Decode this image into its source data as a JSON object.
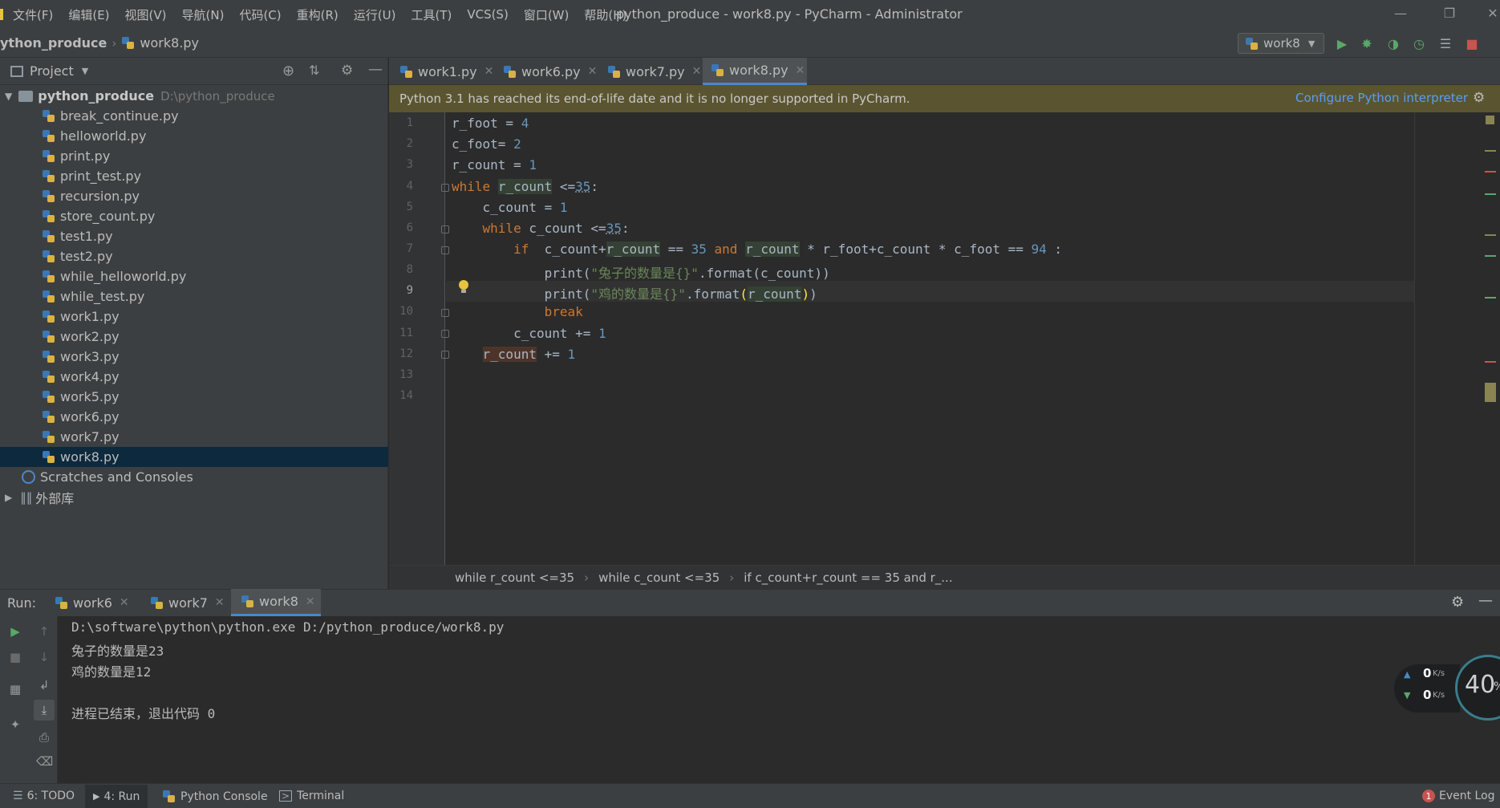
{
  "menu": [
    "文件(F)",
    "编辑(E)",
    "视图(V)",
    "导航(N)",
    "代码(C)",
    "重构(R)",
    "运行(U)",
    "工具(T)",
    "VCS(S)",
    "窗口(W)",
    "帮助(H)"
  ],
  "window_title": "python_produce - work8.py - PyCharm - Administrator",
  "nav": {
    "project": "ython_produce",
    "file": "work8.py"
  },
  "run_config": "work8",
  "project_panel": {
    "title": "Project",
    "root_name": "python_produce",
    "root_path": "D:\\python_produce",
    "files": [
      "break_continue.py",
      "helloworld.py",
      "print.py",
      "print_test.py",
      "recursion.py",
      "store_count.py",
      "test1.py",
      "test2.py",
      "while_helloworld.py",
      "while_test.py",
      "work1.py",
      "work2.py",
      "work3.py",
      "work4.py",
      "work5.py",
      "work6.py",
      "work7.py",
      "work8.py"
    ],
    "selected": "work8.py",
    "scratches": "Scratches and Consoles",
    "external": "外部库"
  },
  "editor_tabs": [
    {
      "label": "work1.py",
      "active": false
    },
    {
      "label": "work6.py",
      "active": false
    },
    {
      "label": "work7.py",
      "active": false
    },
    {
      "label": "work8.py",
      "active": true
    }
  ],
  "banner": {
    "text": "Python 3.1 has reached its end-of-life date and it is no longer supported in PyCharm.",
    "link": "Configure Python interpreter"
  },
  "line_numbers": [
    "1",
    "2",
    "3",
    "4",
    "5",
    "6",
    "7",
    "8",
    "9",
    "10",
    "11",
    "12",
    "13",
    "14"
  ],
  "code": {
    "l1": {
      "v": "r_foot",
      "op": " = ",
      "n": "4"
    },
    "l2": {
      "v": "c_foot",
      "op": "= ",
      "n": "2"
    },
    "l3": {
      "v": "r_count",
      "op": " = ",
      "n": "1"
    },
    "l4": {
      "kw": "while",
      "v": "r_count",
      "op": " <=",
      "n": "35",
      "end": ":"
    },
    "l5": {
      "v": "c_count",
      "op": " = ",
      "n": "1"
    },
    "l6": {
      "kw": "while",
      "v": "c_count",
      "op": " <=",
      "n": "35",
      "end": ":"
    },
    "l7": {
      "kw": "if",
      "a": "  c_count+",
      "b": "r_count",
      "c": " == ",
      "n1": "35",
      "kw2": "and",
      "d": "r_count",
      "e": " * r_foot+c_count * c_foot == ",
      "n2": "94",
      "end": " :"
    },
    "l8": {
      "fn": "print(",
      "s": "\"兔子的数量是{}\"",
      "rest": ".format(c_count))"
    },
    "l9": {
      "fn": "print(",
      "s": "\"鸡的数量是{}\"",
      "rest1": ".format",
      "p": "(",
      "v": "r_count",
      "p2": ")",
      "rest2": ")"
    },
    "l10": {
      "kw": "break"
    },
    "l11": {
      "v": "c_count",
      "op": " += ",
      "n": "1"
    },
    "l12": {
      "v": "r_count",
      "op": " += ",
      "n": "1"
    }
  },
  "editor_breadcrumb": [
    "while r_count <=35",
    "while c_count <=35",
    "if c_count+r_count == 35 and r_..."
  ],
  "run": {
    "label": "Run:",
    "tabs": [
      {
        "label": "work6",
        "active": false
      },
      {
        "label": "work7",
        "active": false
      },
      {
        "label": "work8",
        "active": true
      }
    ],
    "output": [
      "D:\\software\\python\\python.exe D:/python_produce/work8.py",
      "兔子的数量是23",
      "鸡的数量是12",
      "",
      "进程已结束，退出代码 0"
    ]
  },
  "net_widget": {
    "up": "0",
    "down": "0",
    "unit": "K/s",
    "percent": "40",
    "percent_suffix": "%"
  },
  "status_bar": {
    "todo": "6: TODO",
    "run": "4: Run",
    "console": "Python Console",
    "terminal": "Terminal",
    "event_count": "1",
    "event_log": "Event Log"
  }
}
